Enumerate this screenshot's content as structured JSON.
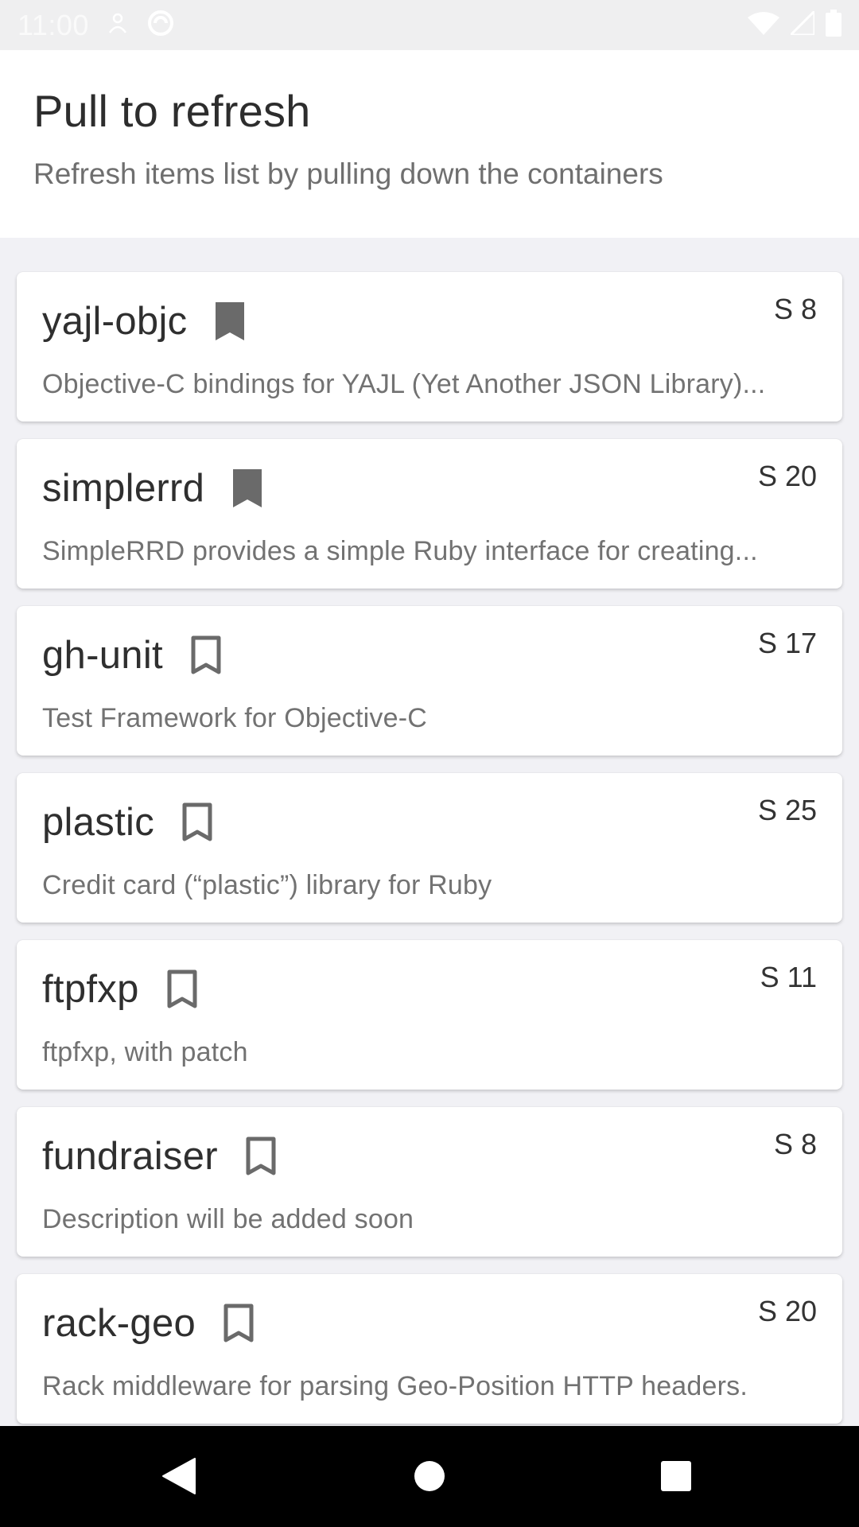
{
  "status_bar": {
    "time": "11:00",
    "icons": [
      "person-icon",
      "sync-icon",
      "wifi-icon",
      "signal-icon",
      "battery-icon"
    ]
  },
  "header": {
    "title": "Pull to refresh",
    "subtitle": "Refresh items list by pulling down the containers"
  },
  "items": [
    {
      "title": "yajl-objc",
      "bookmarked": true,
      "score": "S 8",
      "description": "Objective-C bindings for YAJL (Yet Another JSON Library)..."
    },
    {
      "title": "simplerrd",
      "bookmarked": true,
      "score": "S 20",
      "description": "SimpleRRD provides a simple Ruby interface for creating..."
    },
    {
      "title": "gh-unit",
      "bookmarked": false,
      "score": "S 17",
      "description": "Test Framework for Objective-C"
    },
    {
      "title": "plastic",
      "bookmarked": false,
      "score": "S 25",
      "description": "Credit card (“plastic”) library for Ruby"
    },
    {
      "title": "ftpfxp",
      "bookmarked": false,
      "score": "S 11",
      "description": "ftpfxp, with patch"
    },
    {
      "title": "fundraiser",
      "bookmarked": false,
      "score": "S 8",
      "description": "Description will be added soon"
    },
    {
      "title": "rack-geo",
      "bookmarked": false,
      "score": "S 20",
      "description": "Rack middleware for parsing Geo-Position HTTP headers."
    }
  ],
  "nav": {
    "back": "back-icon",
    "home": "home-icon",
    "recents": "recents-icon"
  },
  "colors": {
    "bookmark": "#6a6a6a",
    "background": "#f1f1f5",
    "card": "#ffffff"
  }
}
